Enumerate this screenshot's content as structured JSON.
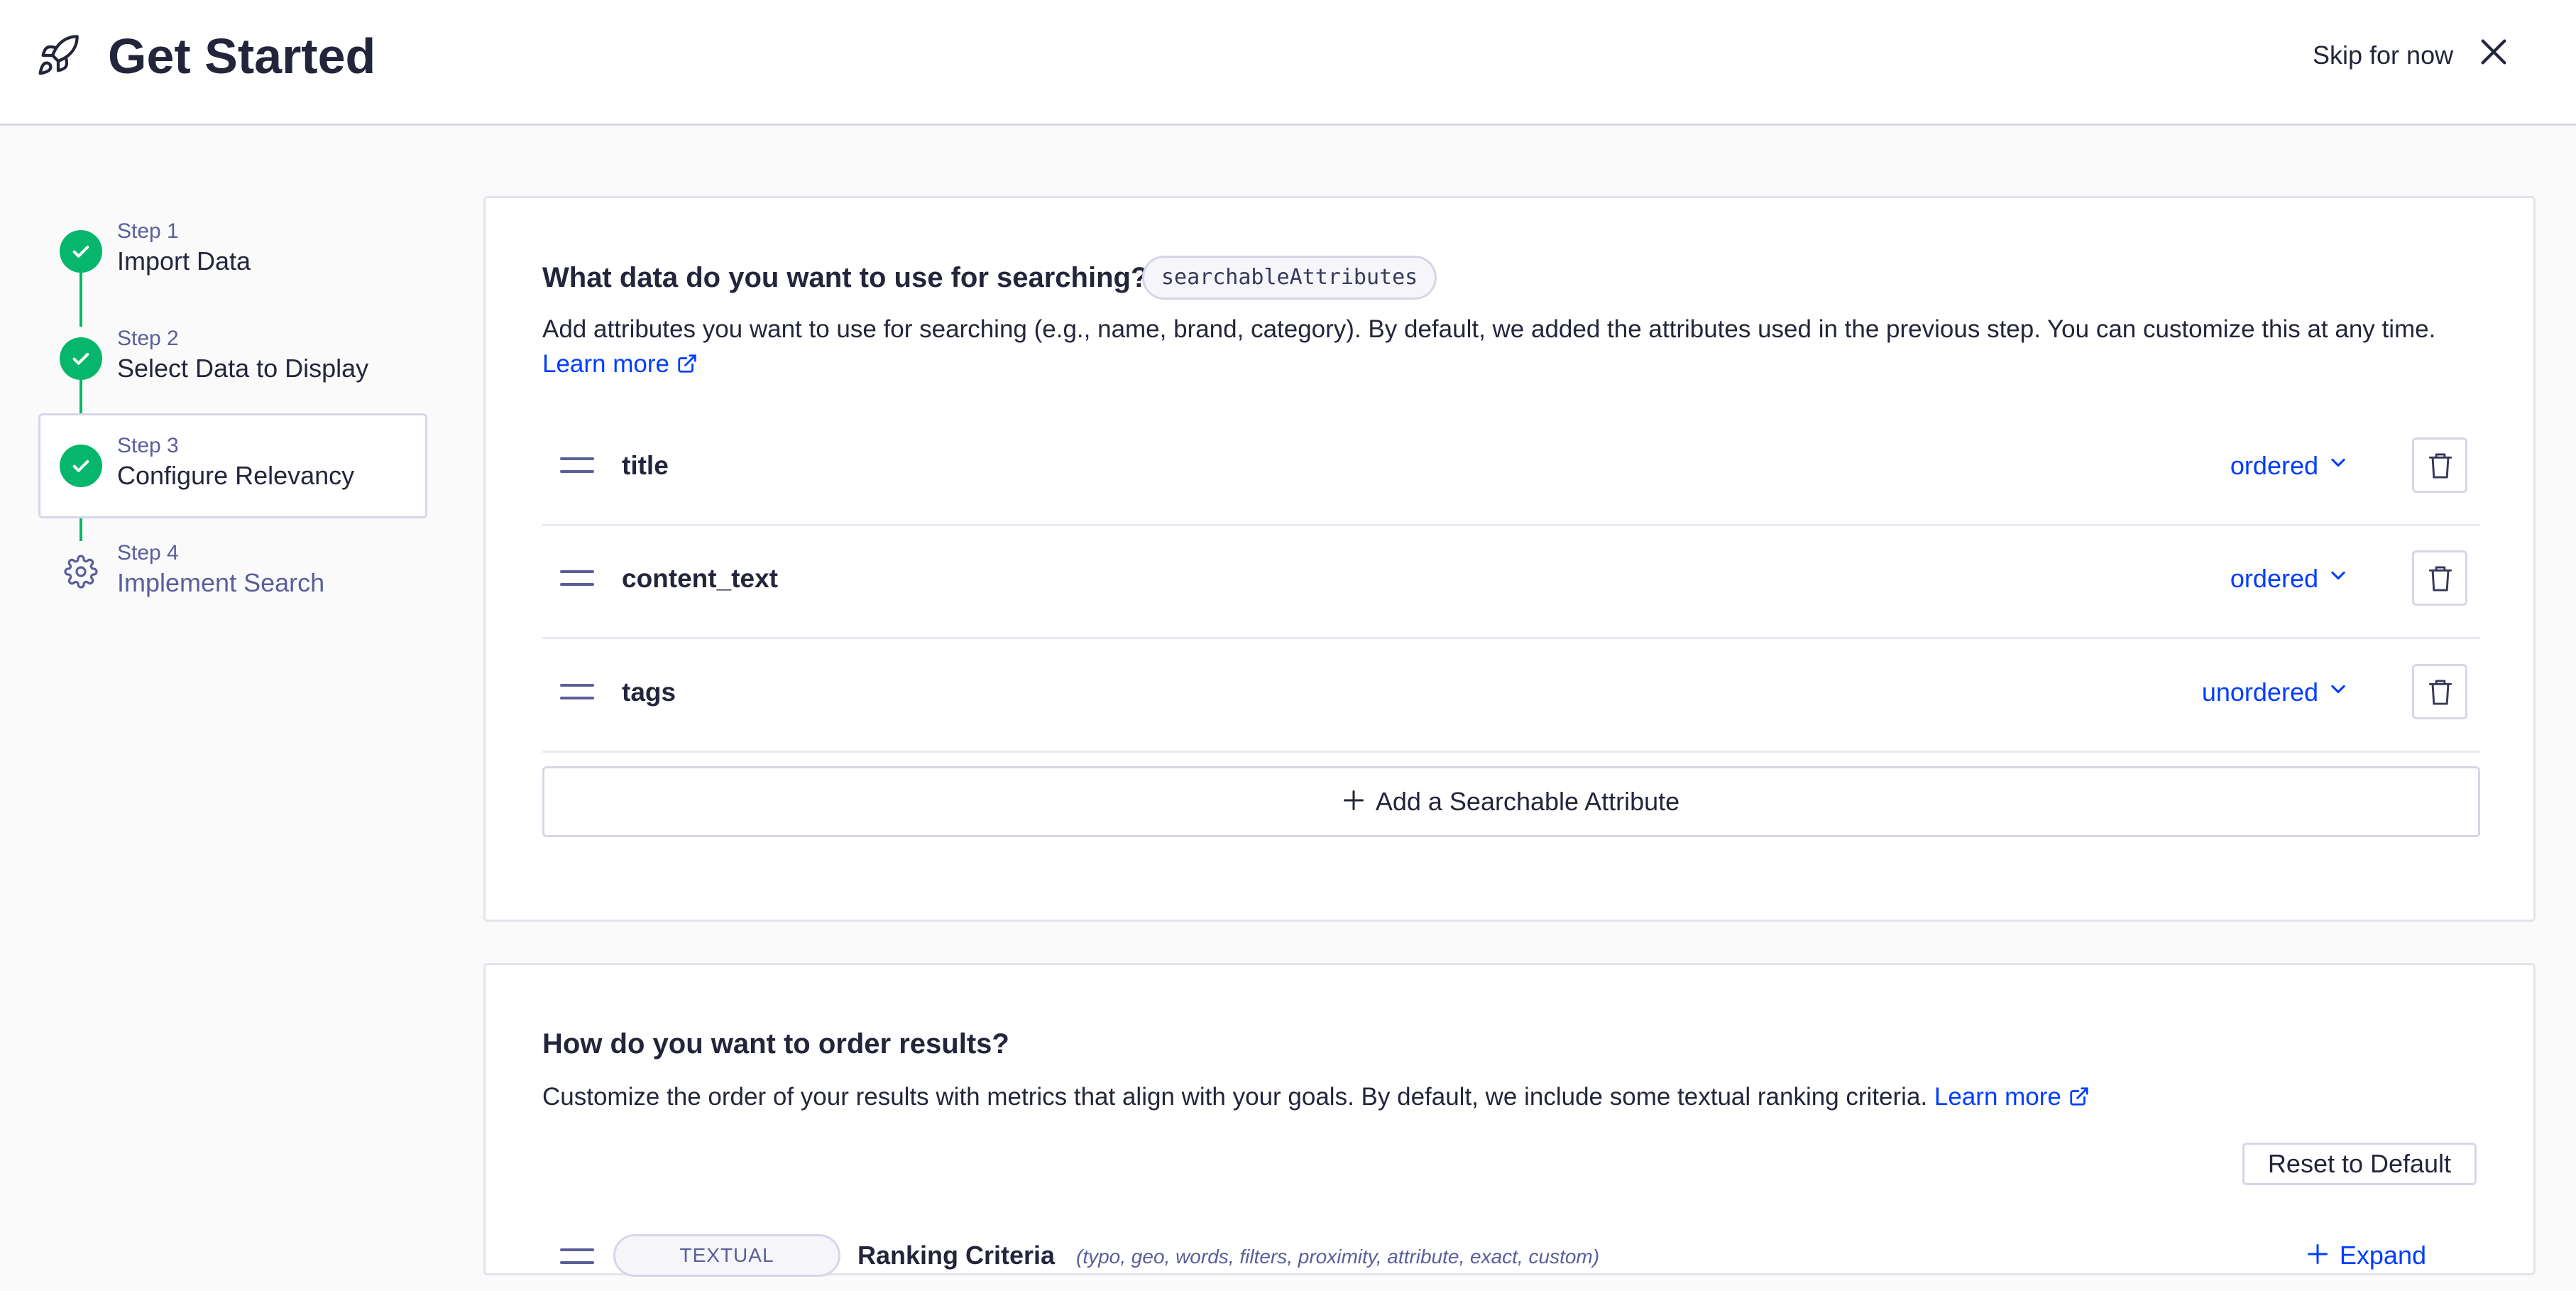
{
  "header": {
    "title": "Get Started",
    "skip_label": "Skip for now",
    "logo_icon": "rocket-icon",
    "close_icon": "close-icon"
  },
  "stepper": {
    "steps": [
      {
        "number": "Step 1",
        "label": "Import Data",
        "status": "complete"
      },
      {
        "number": "Step 2",
        "label": "Select Data to Display",
        "status": "complete"
      },
      {
        "number": "Step 3",
        "label": "Configure Relevancy",
        "status": "complete-active"
      },
      {
        "number": "Step 4",
        "label": "Implement Search",
        "status": "pending"
      }
    ]
  },
  "searchable": {
    "title": "What data do you want to use for searching?",
    "badge": "searchableAttributes",
    "description": "Add attributes you want to use for searching (e.g., name, brand, category). By default, we added the attributes used in the previous step. You can customize this at any time.",
    "learn_more": "Learn more",
    "attributes": [
      {
        "name": "title",
        "mode": "ordered"
      },
      {
        "name": "content_text",
        "mode": "ordered"
      },
      {
        "name": "tags",
        "mode": "unordered"
      }
    ],
    "add_label": "Add a Searchable Attribute"
  },
  "ranking": {
    "title": "How do you want to order results?",
    "description": "Customize the order of your results with metrics that align with your goals. By default, we include some textual ranking criteria.",
    "learn_more": "Learn more",
    "reset_label": "Reset to Default",
    "criteria": {
      "badge": "TEXTUAL",
      "name": "Ranking Criteria",
      "subtitle": "(typo, geo, words, filters, proximity, attribute, exact, custom)",
      "expand_label": "Expand"
    }
  },
  "colors": {
    "accent": "#003dff",
    "success": "#06b66c",
    "text": "#23263b",
    "muted": "#5a5e9a",
    "border": "#d6d6e7"
  }
}
